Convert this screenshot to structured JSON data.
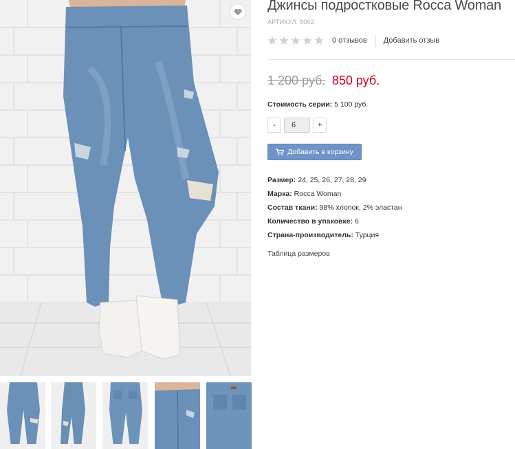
{
  "product": {
    "title": "Джинсы подростковые Rocca Woman",
    "sku_label": "АРТИКУЛ:",
    "sku_value": "5002",
    "rating_stars": 0,
    "reviews_count": "0 отзывов",
    "add_review": "Добавить отзыв",
    "old_price": "1 200 руб.",
    "new_price": "850 руб.",
    "series_label": "Стоимость серии:",
    "series_value": "5 100 руб.",
    "quantity": "6",
    "qty_minus": "-",
    "qty_plus": "+",
    "add_to_cart": "Добавить в корзину",
    "specs": [
      {
        "label": "Размер:",
        "value": "24, 25, 26, 27, 28, 29"
      },
      {
        "label": "Марка:",
        "value": "Rocca Woman"
      },
      {
        "label": "Состав ткани:",
        "value": "98% хлопок, 2% эластан"
      },
      {
        "label": "Количество в упаковке:",
        "value": "6"
      },
      {
        "label": "Страна-производитель:",
        "value": "Турция"
      }
    ],
    "size_table_link": "Таблица размеров"
  },
  "gallery": {
    "main_image": "jeans-front-photo",
    "thumbnails": [
      "jeans-front-thumb",
      "jeans-side-thumb",
      "jeans-back-thumb",
      "jeans-waist-detail-thumb",
      "jeans-back-pocket-thumb"
    ]
  },
  "icons": {
    "favorite": "heart-icon",
    "cart": "cart-icon",
    "star": "star-icon"
  },
  "colors": {
    "accent_button": "#6f94c8",
    "sale_price": "#d0021b",
    "old_price": "#9a9a9a",
    "star_empty": "#d0d0d0",
    "denim": "#5f86ad"
  }
}
